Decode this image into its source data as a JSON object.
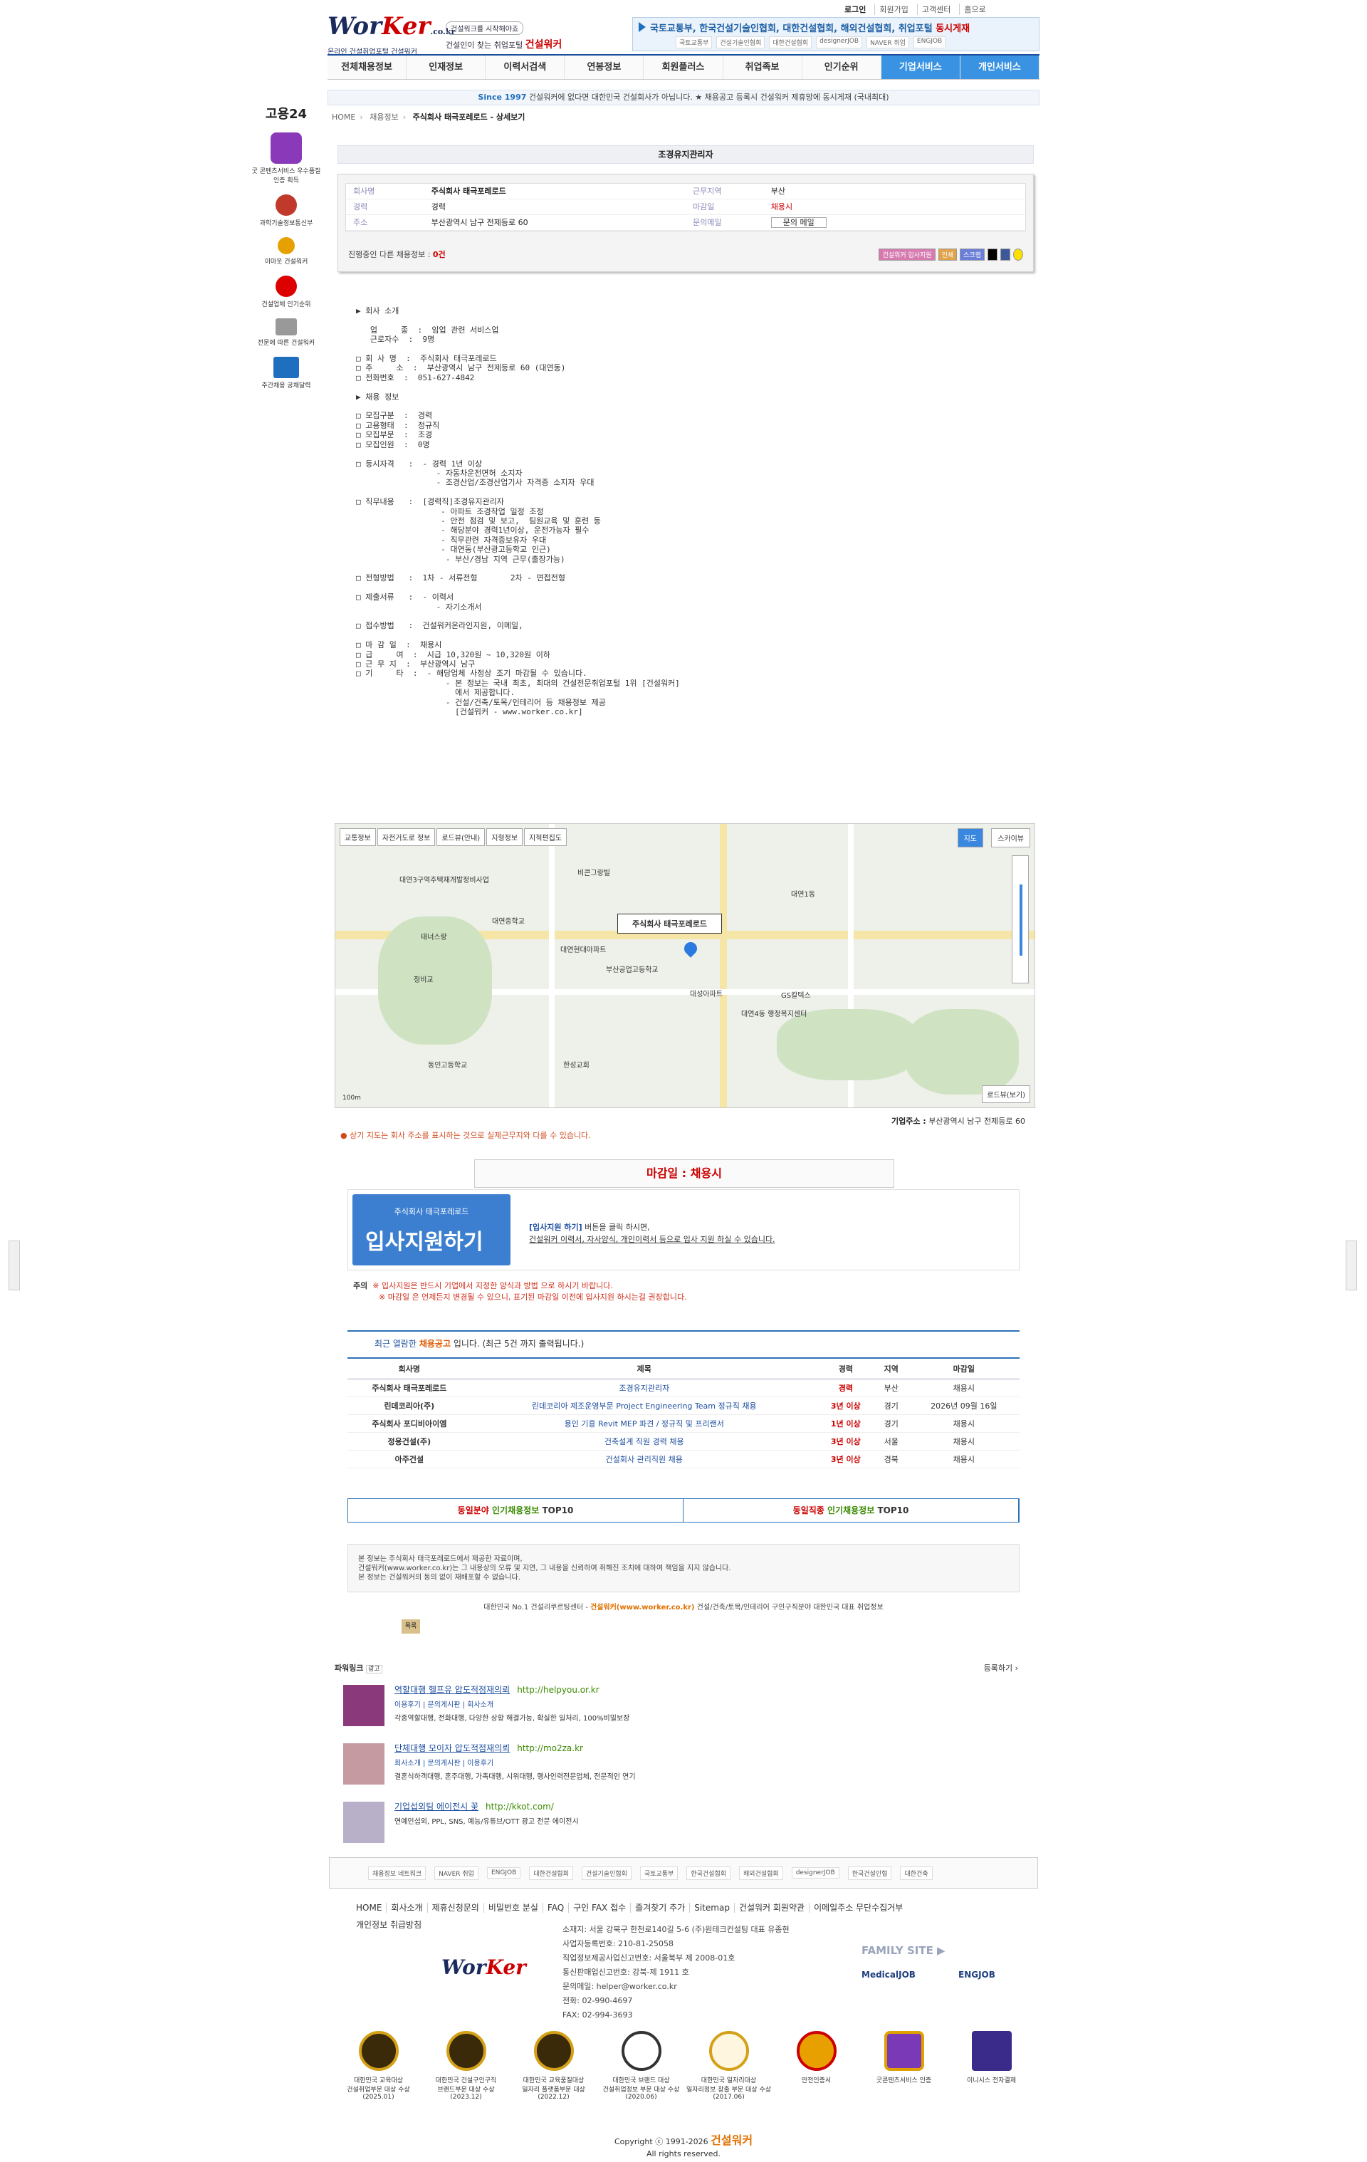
{
  "util": [
    "로그인",
    "회원가입",
    "고객센터",
    "홈으로"
  ],
  "logo": {
    "name_a": "Wor",
    "name_b": "Ker",
    "suffix": ".co.kr",
    "tag": "온라인 건설취업포털 건설워커"
  },
  "slogan": {
    "pill": "건설워크를 시작해야죠",
    "line": "건설인이 찾는 취업포털",
    "brand": "건설워커"
  },
  "banner": {
    "text": "국토교통부, 한국건설기술인협회, 대한건설협회, 해외건설협회, 취업포털",
    "highlight": "동시게재",
    "logos": [
      "국토교통부",
      "건설기술인협회",
      "대한건설협회",
      "designerJOB",
      "NAVER 취업",
      "ENGJOB"
    ]
  },
  "nav": [
    "전체채용정보",
    "인재정보",
    "이력서검색",
    "연봉정보",
    "회원플러스",
    "취업족보",
    "인기순위",
    "기업서비스",
    "개인서비스"
  ],
  "notice": {
    "since": "Since 1997",
    "text": "건설워커에 없다면 대한민국 건설회사가 아닙니다. ★ 채용공고 등록시 건설워커 제휴망에 동시게재 (국내최대)"
  },
  "breadcrumb": [
    "HOME",
    "채용정보",
    "주식회사 태극포레로드 - 상세보기"
  ],
  "left_ads": [
    "고용24",
    "굿 콘텐츠서비스 우수품질인증 획득",
    "과학기술정보통신부",
    "이마웃 건설워커",
    "건설업체 인기순위",
    "전문에 따른 건설워커",
    "주간채용 공채달력"
  ],
  "job": {
    "title": "조경유지관리자",
    "fields": [
      {
        "k": "회사명",
        "v": "주식회사 태극포레로드",
        "k2": "근무지역",
        "v2": "부산"
      },
      {
        "k": "경력",
        "v": "경력",
        "k2": "마감일",
        "v2": "채용시"
      },
      {
        "k": "주소",
        "v": "부산광역시 남구 전제등로 60",
        "k2": "문의메일",
        "v2": "문의 메일"
      }
    ],
    "foot_label": "진행중인 다른 채용정보 :",
    "foot_count": "0건",
    "buttons": [
      "건설워커 입사지원",
      "인쇄",
      "스크랩"
    ]
  },
  "detail": "▶ 회사 소개\n\n   업     종  :  임업 관련 서비스업\n   근로자수  :  9명\n\n□ 회 사 명  :  주식회사 태극포레로드\n□ 주     소  :  부산광역시 남구 전제등로 60 (대연동)\n□ 전화번호  :  051-627-4842\n\n▶ 채용 정보\n\n□ 모집구분  :  경력\n□ 고용형태  :  정규직\n□ 모집부문  :  조경\n□ 모집인원  :  0명\n\n□ 등시자격   :  - 경력 1년 이상\n                 - 자동차운전면허 소지자\n                 - 조경산업/조경산업기사 자격증 소지자 우대\n\n□ 직무내용   :  [경력직]조경유지관리자\n                  - 아파트 조경작업 일정 조정\n                  - 안전 점검 및 보고,  팀원교육 및 훈련 등\n                  - 해당분야 경력1년이상, 운전가능자 필수\n                  - 직무관련 자격증보유자 우대\n                  - 대연동(부산광고등학교 인근)\n                   - 부산/경남 지역 근무(출장가능)\n\n□ 전형방법   :  1차 - 서류전형       2차 - 면접전형\n\n□ 제출서류   :  - 이력서\n                 - 자기소개서\n\n□ 접수방법   :  건설워커온라인지원, 이메일,\n\n□ 마 감 일  :  채용시\n□ 급     여  :  시급 10,320원 ~ 10,320원 이하\n□ 근 무 지  :  부산광역시 남구\n□ 기     타  :  - 해당업체 사정상 조기 마감될 수 있습니다.\n                   - 본 정보는 국내 최초, 최대의 건설전문취업포털 1위 [건설워커]\n                     에서 제공합니다.\n                   - 건설/건축/토목/인테리어 등 채용정보 제공\n                     [건설워커 - www.worker.co.kr]",
  "map": {
    "buttons": [
      "교통정보",
      "자전거도로 정보",
      "로드뷰(안내)",
      "지형정보",
      "지적편집도"
    ],
    "view_on": "지도",
    "view_off": "스카이뷰",
    "label": "주식회사 태극포레로드",
    "roadview": "로드뷰(보기)",
    "scale": "100m",
    "places": [
      "대연1동",
      "대연중학교",
      "대연현대아파트",
      "부산공업고등학교",
      "대성아파트",
      "GS칼텍스",
      "대연4동 행정복지센터",
      "태너스랑",
      "정비교",
      "대연3구역주택재개발정비사업",
      "동인고등학교",
      "한성교회",
      "비콘그랑빌"
    ]
  },
  "address": {
    "label": "기업주소 :",
    "value": "부산광역시 남구 전제등로 60"
  },
  "warning": "상기 지도는 회사 주소를 표시하는 것으로 실제근무지와 다를 수 있습니다.",
  "deadline": {
    "label": "마감일 :",
    "value": "채용시"
  },
  "apply": {
    "company": "주식회사 태극포레로드",
    "button": "입사지원하기",
    "desc_b": "[입사지원 하기]",
    "desc1": " 버튼을 클릭 하시면,",
    "desc2": "건설워커 이력서, 자사양식, 개인이력서 등으로 입사 지원 하실 수 있습니다."
  },
  "caution": {
    "label": "주의",
    "l1": "※ 입사지원은 반드시 기업에서 지정한 양식과 방법 으로 하시기 바랍니다.",
    "l2": "※ 마감일 은 언제든지 변경될 수 있으니, 표기된 마감일 이전에 입사지원 하시는걸 권장합니다."
  },
  "recent": {
    "prefix": "최근 열람한",
    "hl": "채용공고",
    "suffix": "입니다.  (최근 5건 까지 출력됩니다.)"
  },
  "recent_table": {
    "headers": [
      "회사명",
      "제목",
      "경력",
      "지역",
      "마감일"
    ],
    "rows": [
      [
        "주식회사 태극포레로드",
        "조경유지관리자",
        "경력",
        "부산",
        "채용시"
      ],
      [
        "린데코리아(주)",
        "린데코리아 제조운영부문 Project Engineering Team 정규직 채용",
        "3년 이상",
        "경기",
        "2026년 09월 16일"
      ],
      [
        "주식회사 포디비아이엠",
        "용인 기흥 Revit MEP 파견 / 정규직 및 프리랜서",
        "1년 이상",
        "경기",
        "채용시"
      ],
      [
        "정용건설(주)",
        "건축설계 직원 경력 채용",
        "3년 이상",
        "서울",
        "채용시"
      ],
      [
        "아주건설",
        "건설회사 관리직원 채용",
        "3년 이상",
        "경북",
        "채용시"
      ]
    ]
  },
  "top10": [
    {
      "a": "동일분야",
      "b": "인기채용정보",
      "c": "TOP10"
    },
    {
      "a": "동일직종",
      "b": "인기채용정보",
      "c": "TOP10"
    }
  ],
  "disclaimer": [
    "본 정보는 주식회사 태극포레로드에서 제공한 자료이며,",
    "건설워커(www.worker.co.kr)는 그 내용상의 오류 및 지연, 그 내용을 신뢰하여 취해진 조치에 대하여 책임을 지지 않습니다.",
    "본 정보는 건설워커의 동의 없이 재배포할 수 없습니다."
  ],
  "copyline": {
    "a": "대한민국 No.1 건설리쿠르팅센터 - ",
    "b": "건설워커(www.worker.co.kr)",
    "c": " 건설/건축/토목/인테리어 구인구직분야 대한민국 대표 취업정보"
  },
  "list_button": "목록",
  "powerlink": {
    "title": "파워링크",
    "ad": "광고",
    "register": "등록하기 ›",
    "items": [
      {
        "title": "역할대행 헬프유 압도적점재의뢰",
        "url": "http://helpyou.or.kr",
        "links": "이용후기 | 문의게시판 | 회사소개",
        "desc": "각종역할대행, 전화대행, 다양한 상황 해결가능, 확실한 일처리, 100%비밀보장"
      },
      {
        "title": "단체대행 모이자 압도적점재의뢰",
        "url": "http://mo2za.kr",
        "links": "회사소개 | 문의게시판 | 이용후기",
        "desc": "결혼식하객대행, 혼주대행, 가족대행, 시위대행, 행사인력전문업체, 전문적인 연기"
      },
      {
        "title": "기업섭외팀 에이전시 꽃",
        "url": "http://kkot.com/",
        "links": "",
        "desc": "연예인섭외, PPL, SNS, 예능/유튜브/OTT 광고 전문 에이전시"
      }
    ]
  },
  "partners": [
    "채용정보 네트워크",
    "NAVER 취업",
    "ENGJOB",
    "대한건설협회",
    "건설기술인협회",
    "국토교통부",
    "한국건설협회",
    "해외건설협회",
    "designerJOB",
    "한국건설인협",
    "대한건축"
  ],
  "footer_nav": [
    "HOME",
    "회사소개",
    "제휴신청문의",
    "비밀번호 분실",
    "FAQ",
    "구인 FAX 접수",
    "즐겨찾기 추가",
    "Sitemap",
    "건설워커 회원약관",
    "이메일주소 무단수집거부"
  ],
  "footer_nav2": "개인정보 취급방침",
  "footer_info": [
    "소재지: 서울 강북구 한천로140길 5-6 (주)원테크컨설팅 대표 유종현",
    "사업자등록번호: 210-81-25058",
    "직업정보제공사업신고번호: 서울북부 제 2008-01호",
    "통신판매업신고번호: 강북-제 1911 호",
    "문의메일: helper@worker.co.kr",
    "전화: 02-990-4697",
    "FAX: 02-994-3693"
  ],
  "family": {
    "title": "FAMILY SITE ▶",
    "a": "MedicalJOB",
    "b": "ENGJOB"
  },
  "awards": [
    {
      "l1": "대한민국 교육대상",
      "l2": "건설취업부문 대상 수상",
      "l3": "(2025.01)"
    },
    {
      "l1": "대한민국 건설구인구직",
      "l2": "브랜드부문 대상 수상",
      "l3": "(2023.12)"
    },
    {
      "l1": "대한민국 교육품질대상",
      "l2": "일자리 플랫폼부문 대상",
      "l3": "(2022.12)"
    },
    {
      "l1": "대한민국 브랜드 대상",
      "l2": "건설취업정보 부문 대상 수상",
      "l3": "(2020.06)"
    },
    {
      "l1": "대한민국 일자리대상",
      "l2": "일자리정보 창출 부문 대상 수상",
      "l3": "(2017.06)"
    },
    {
      "l1": "안전인증서",
      "l2": "",
      "l3": ""
    },
    {
      "l1": "굿콘텐츠서비스 인증",
      "l2": "",
      "l3": ""
    },
    {
      "l1": "이니시스 전자결제",
      "l2": "",
      "l3": ""
    }
  ],
  "copyright": {
    "a": "Copyright ⓒ 1991-2026",
    "b": "건설워커",
    "c": "All rights reserved."
  }
}
